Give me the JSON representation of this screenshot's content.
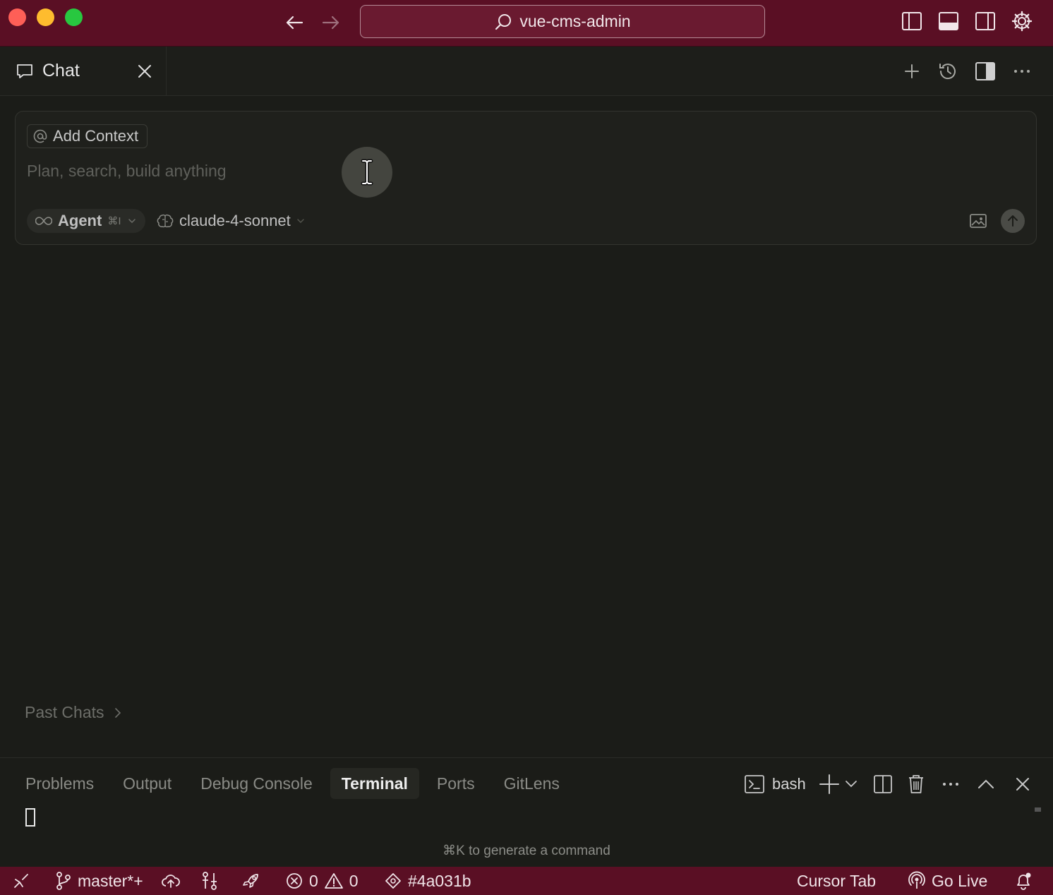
{
  "window": {
    "project_name": "vue-cms-admin",
    "colors": {
      "titlebar": "#5a0f24",
      "background": "#1b1c18",
      "accent": "#6a1a30"
    }
  },
  "tab": {
    "label": "Chat"
  },
  "composer": {
    "add_context_label": "Add Context",
    "placeholder": "Plan, search, build anything",
    "mode_label": "Agent",
    "mode_shortcut": "⌘I",
    "model_label": "claude-4-sonnet"
  },
  "past_chats_label": "Past Chats",
  "panel": {
    "tabs": [
      "Problems",
      "Output",
      "Debug Console",
      "Terminal",
      "Ports",
      "GitLens"
    ],
    "active_tab": "Terminal",
    "shell_label": "bash",
    "hint": "⌘K to generate a command"
  },
  "statusbar": {
    "branch": "master*+",
    "errors": "0",
    "warnings": "0",
    "commit": "#4a031b",
    "cursor_tab": "Cursor Tab",
    "go_live": "Go Live"
  }
}
